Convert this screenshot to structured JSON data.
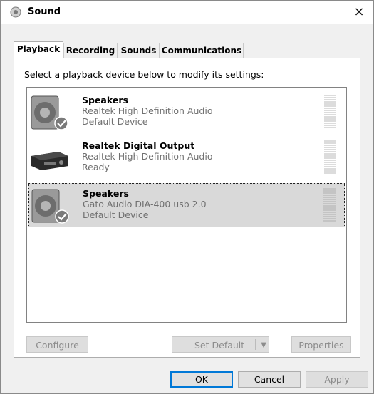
{
  "window": {
    "title": "Sound",
    "close_glyph": "×"
  },
  "tabs": [
    {
      "label": "Playback",
      "active": true
    },
    {
      "label": "Recording",
      "active": false
    },
    {
      "label": "Sounds",
      "active": false
    },
    {
      "label": "Communications",
      "active": false
    }
  ],
  "instruction": "Select a playback device below to modify its settings:",
  "devices": [
    {
      "name": "Speakers",
      "line1": "Realtek High Definition Audio",
      "line2": "Default Device",
      "icon": "speaker-icon",
      "default": true,
      "selected": false
    },
    {
      "name": "Realtek Digital Output",
      "line1": "Realtek High Definition Audio",
      "line2": "Ready",
      "icon": "receiver-icon",
      "default": false,
      "selected": false
    },
    {
      "name": "Speakers",
      "line1": "Gato Audio DIA-400 usb 2.0",
      "line2": "Default Device",
      "icon": "speaker-icon",
      "default": true,
      "selected": true
    }
  ],
  "panel_buttons": {
    "configure": "Configure",
    "set_default": "Set Default",
    "properties": "Properties"
  },
  "dialog_buttons": {
    "ok": "OK",
    "cancel": "Cancel",
    "apply": "Apply"
  },
  "colors": {
    "accent_check": "#4caf50",
    "disabled_text": "#8c8c8c",
    "selection_bg": "#d9d9d9"
  }
}
